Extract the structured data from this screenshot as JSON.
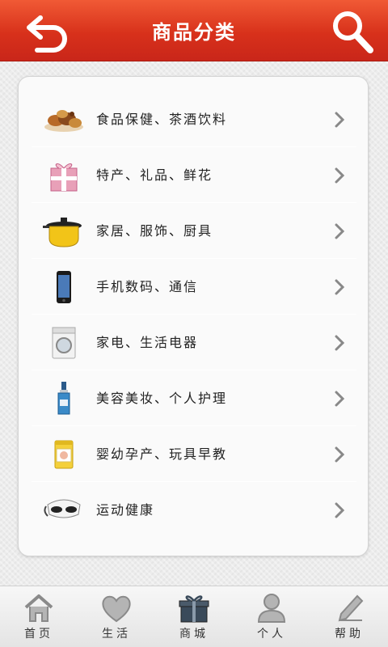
{
  "header": {
    "title": "商品分类",
    "bg_color": "#d8311b",
    "back_icon": "back-arrow-icon",
    "search_icon": "search-icon"
  },
  "categories": [
    {
      "label": "食品保健、茶酒饮料",
      "icon": "food-icon"
    },
    {
      "label": "特产、礼品、鲜花",
      "icon": "gift-box-icon"
    },
    {
      "label": "家居、服饰、厨具",
      "icon": "cooking-pot-icon"
    },
    {
      "label": "手机数码、通信",
      "icon": "smartphone-icon"
    },
    {
      "label": "家电、生活电器",
      "icon": "washing-machine-icon"
    },
    {
      "label": "美容美妆、个人护理",
      "icon": "cosmetics-bottle-icon"
    },
    {
      "label": "婴幼孕产、玩具早教",
      "icon": "milk-powder-can-icon"
    },
    {
      "label": "运动健康",
      "icon": "eye-massager-icon"
    }
  ],
  "tabbar": {
    "tabs": [
      {
        "label": "首页",
        "icon": "home-icon"
      },
      {
        "label": "生活",
        "icon": "heart-icon"
      },
      {
        "label": "商城",
        "icon": "gift-icon",
        "active": true
      },
      {
        "label": "个人",
        "icon": "person-icon"
      },
      {
        "label": "帮助",
        "icon": "pencil-icon"
      }
    ]
  }
}
